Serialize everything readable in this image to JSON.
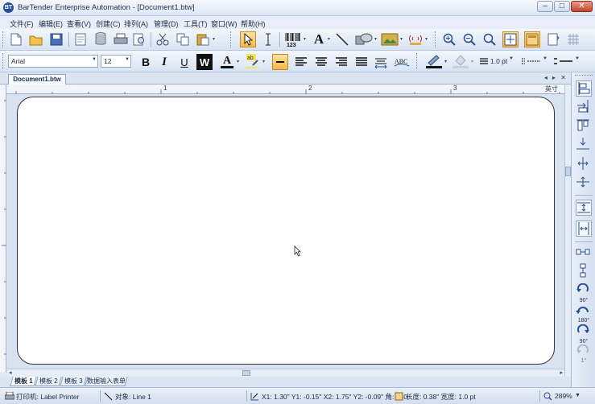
{
  "window": {
    "title": "BarTender Enterprise Automation - [Document1.btw]",
    "app_icon_text": "BT",
    "minimize": "–",
    "maximize": "□",
    "close": "✕"
  },
  "menu": [
    {
      "label": "文件(F)"
    },
    {
      "label": "编辑(E)"
    },
    {
      "label": "查看(V)"
    },
    {
      "label": "创建(C)"
    },
    {
      "label": "排列(A)"
    },
    {
      "label": "管理(D)"
    },
    {
      "label": "工具(T)"
    },
    {
      "label": "窗口(W)"
    },
    {
      "label": "帮助(H)"
    }
  ],
  "toolbar": {
    "font_name": "Arial",
    "font_size": "12",
    "line_width": "1.0 pt",
    "barcode_label": "123"
  },
  "document": {
    "tab_label": "Document1.btw",
    "tab_controls": "◂ ▸ ✕"
  },
  "ruler": {
    "marks": [
      "1",
      "2",
      "3"
    ],
    "unit": "英寸"
  },
  "sheets": [
    {
      "label": "模板 1",
      "active": true
    },
    {
      "label": "模板 2",
      "active": false
    },
    {
      "label": "模板 3",
      "active": false
    },
    {
      "label": "数据输入表单",
      "active": false
    }
  ],
  "rightbar": {
    "rotate_90": "90°",
    "rotate_180": "180°",
    "rotate_neg90": "90°",
    "rotate_1": "1°"
  },
  "status": {
    "printer": "打印机: Label Printer",
    "object": "对象: Line 1",
    "coords": "X1: 1.30\"  Y1: -0.15\"  X2: 1.75\"  Y2: -0.09\"  角: 350",
    "length": "长度: 0.38\"  宽度: 1.0 pt",
    "zoom": "289%"
  }
}
